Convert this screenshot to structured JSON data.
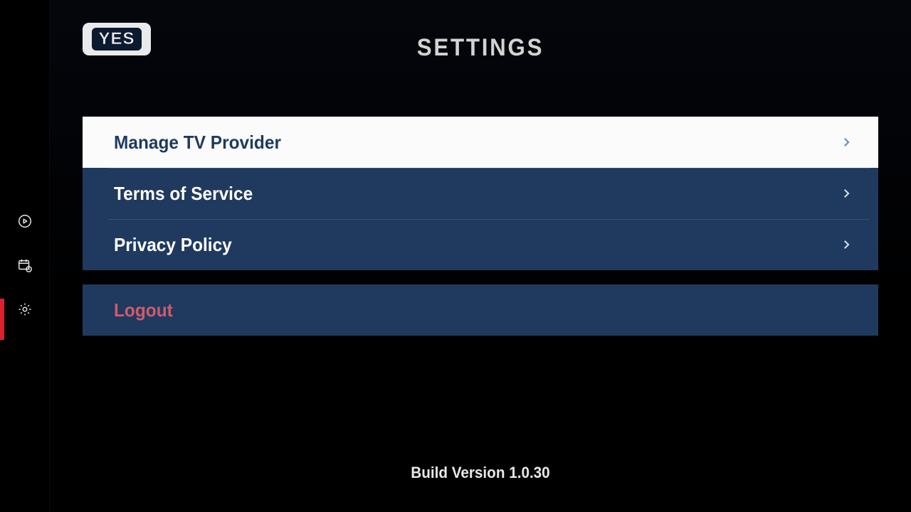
{
  "logo_text": "YES",
  "page_title": "SETTINGS",
  "sidebar": {
    "items": [
      {
        "icon": "play-circle-icon",
        "active": false
      },
      {
        "icon": "schedule-icon",
        "active": false
      },
      {
        "icon": "gear-icon",
        "active": true
      }
    ]
  },
  "groups": [
    {
      "rows": [
        {
          "label": "Manage TV Provider",
          "chevron": true,
          "focused": true
        },
        {
          "label": "Terms of Service",
          "chevron": true,
          "focused": false
        },
        {
          "label": "Privacy Policy",
          "chevron": true,
          "focused": false
        }
      ]
    },
    {
      "rows": [
        {
          "label": "Logout",
          "chevron": false,
          "focused": false,
          "danger": true
        }
      ]
    }
  ],
  "build_version_label": "Build Version 1.0.30"
}
